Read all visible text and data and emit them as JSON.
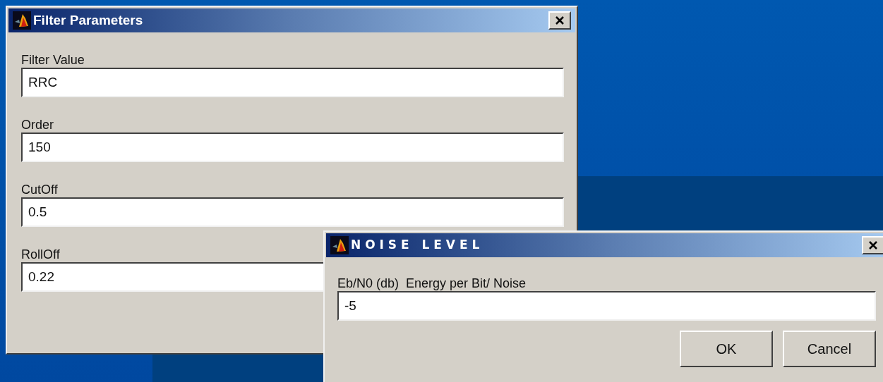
{
  "filter_window": {
    "title": "Filter Parameters",
    "fields": [
      {
        "label": "Filter Value",
        "value": "RRC"
      },
      {
        "label": "Order",
        "value": "150"
      },
      {
        "label": "CutOff",
        "value": "0.5"
      },
      {
        "label": "RollOff",
        "value": "0.22"
      }
    ]
  },
  "noise_window": {
    "title": "NOISE LEVEL",
    "fields": [
      {
        "label": "Eb/N0 (db)  Energy per Bit/ Noise",
        "value": "-5"
      }
    ],
    "buttons": [
      "OK",
      "Cancel"
    ]
  }
}
